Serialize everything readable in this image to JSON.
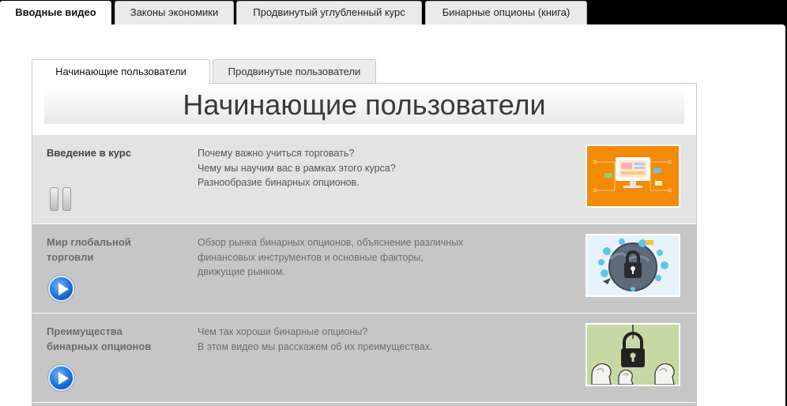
{
  "top_tabs": [
    {
      "label": "Вводные видео",
      "active": true
    },
    {
      "label": "Законы экономики",
      "active": false
    },
    {
      "label": "Продвинутый углубленный курс",
      "active": false
    },
    {
      "label": "Бинарные опционы (книга)",
      "active": false
    }
  ],
  "sub_tabs": [
    {
      "label": "Начинающие пользователи",
      "active": true
    },
    {
      "label": "Продвинутые пользователи",
      "active": false
    }
  ],
  "section_title": "Начинающие пользователи",
  "lessons": [
    {
      "title": "Введение в курс",
      "description": [
        "Почему важно учиться торговать?",
        "Чему мы научим вас в рамках этого курса?",
        "Разнообразие бинарных опционов."
      ],
      "state": "playing",
      "thumbnail": "computer-screen-icon"
    },
    {
      "title": "Мир глобальной торговли",
      "description": [
        "Обзор рынка бинарных опционов, объяснение различных",
        "финансовых инструментов и основные факторы,",
        "движущие рынком."
      ],
      "state": "paused",
      "thumbnail": "globe-lock-icon"
    },
    {
      "title": "Преимущества бинарных опционов",
      "description": [
        "Чем так хороши бинарные опционы?",
        "В этом видео мы расскажем об их преимуществах."
      ],
      "state": "paused",
      "thumbnail": "lock-heads-icon"
    }
  ],
  "colors": {
    "active_row": "#e3e3e3",
    "inactive_row": "#c6c6c6",
    "thumb1_bg": "#f58a07",
    "thumb2_bg": "#e8f2fa",
    "thumb3_bg": "#c6d8a4"
  }
}
